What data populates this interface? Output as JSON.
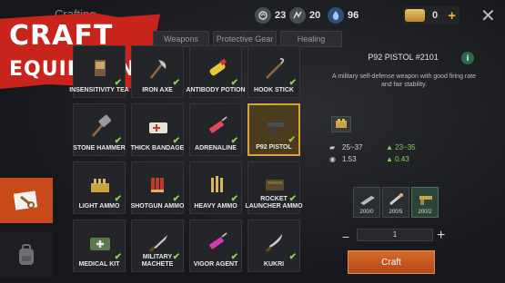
{
  "header": {
    "title": "Crafting",
    "stats": [
      {
        "name": "hunger",
        "icon": "hunger-icon",
        "value": "23"
      },
      {
        "name": "stamina",
        "icon": "stamina-icon",
        "value": "20"
      },
      {
        "name": "water",
        "icon": "water-drop-icon",
        "value": "96"
      }
    ],
    "coins": {
      "value": "0",
      "icon": "coin-bar-icon",
      "add_label": "+"
    },
    "close_label": "✕"
  },
  "banner": {
    "line1": "CRAFT",
    "line2": "EQUIPMENT"
  },
  "tabs": [
    {
      "label": "Weapons"
    },
    {
      "label": "Protective Gear"
    },
    {
      "label": "Healing"
    }
  ],
  "sidenav": [
    {
      "icon": "tools-icon",
      "active": true
    },
    {
      "icon": "backpack-icon",
      "active": false
    }
  ],
  "items": [
    {
      "label": "INSENSITIVITY TEA",
      "icon": "tea-icon",
      "checked": true
    },
    {
      "label": "IRON AXE",
      "icon": "axe-icon",
      "checked": true
    },
    {
      "label": "ANTIBODY POTION",
      "icon": "potion-icon",
      "checked": true
    },
    {
      "label": "HOOK STICK",
      "icon": "hook-stick-icon",
      "checked": true
    },
    {
      "label": "STONE HAMMER",
      "icon": "hammer-icon",
      "checked": true
    },
    {
      "label": "THICK BANDAGE",
      "icon": "bandage-icon",
      "checked": true
    },
    {
      "label": "ADRENALINE",
      "icon": "syringe-icon",
      "checked": true
    },
    {
      "label": "P92 PISTOL",
      "icon": "pistol-icon",
      "checked": true,
      "selected": true
    },
    {
      "label": "LIGHT AMMO",
      "icon": "light-ammo-icon",
      "checked": true
    },
    {
      "label": "SHOTGUN AMMO",
      "icon": "shotgun-ammo-icon",
      "checked": true
    },
    {
      "label": "HEAVY AMMO",
      "icon": "heavy-ammo-icon",
      "checked": true
    },
    {
      "label": "ROCKET LAUNCHER AMMO",
      "icon": "rocket-ammo-icon",
      "checked": true
    },
    {
      "label": "MEDICAL KIT",
      "icon": "medkit-icon",
      "checked": true
    },
    {
      "label": "MILITARY MACHETE",
      "icon": "machete-icon",
      "checked": true
    },
    {
      "label": "VIGOR AGENT",
      "icon": "vigor-syringe-icon",
      "checked": true
    },
    {
      "label": "KUKRI",
      "icon": "kukri-icon",
      "checked": true
    }
  ],
  "detail": {
    "name": "P92 PISTOL #2101",
    "info_label": "i",
    "description": "A military self-defense weapon with good firing rate and fair stability.",
    "stats": [
      {
        "icon": "damage-icon",
        "base": "25~37",
        "upgraded": "23~35"
      },
      {
        "icon": "fire-rate-icon",
        "base": "1.53",
        "upgraded": "0.43"
      }
    ],
    "materials": [
      {
        "icon": "metal-parts-icon",
        "count": "200/0"
      },
      {
        "icon": "spring-parts-icon",
        "count": "200/5"
      },
      {
        "icon": "pistol-parts-icon",
        "count": "200/2"
      }
    ],
    "quantity": "1",
    "minus_label": "−",
    "plus_label": "+",
    "craft_label": "Craft"
  },
  "colors": {
    "accent": "#c84a18",
    "banner_red": "#c8241c",
    "check": "#8ed14a",
    "upgrade": "#7fd35a"
  }
}
